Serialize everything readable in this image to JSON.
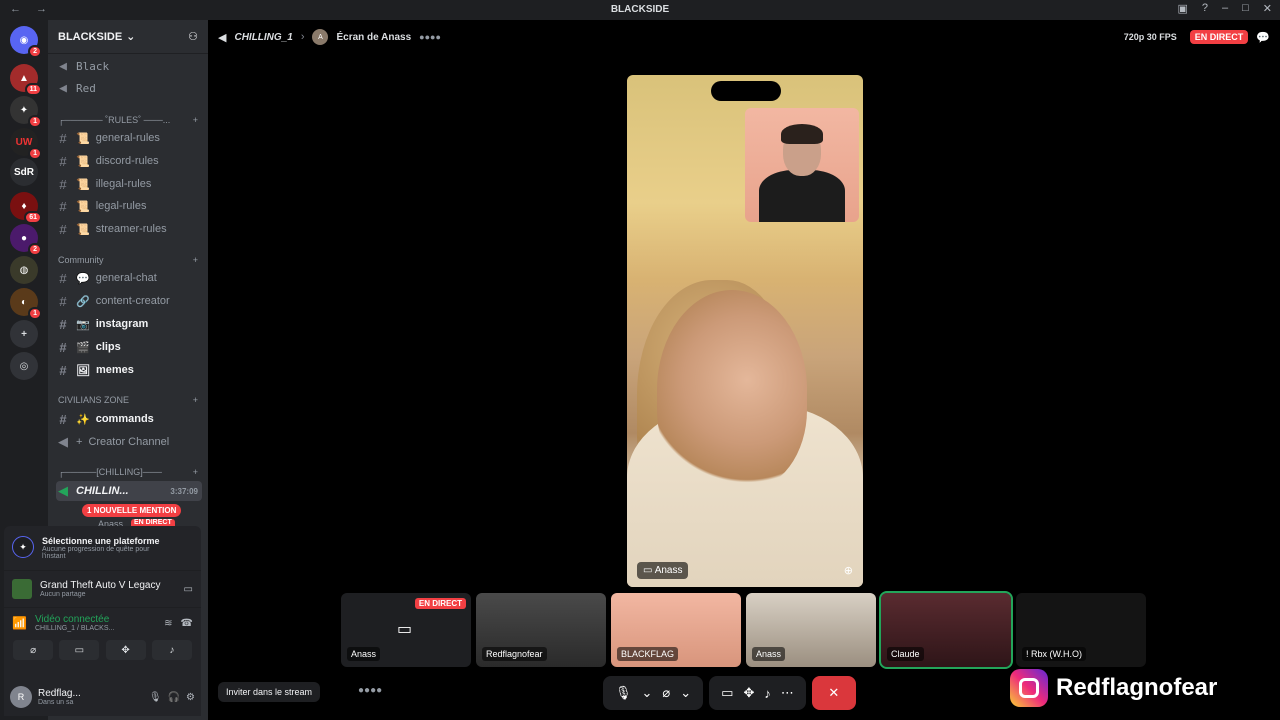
{
  "window": {
    "title": "BLACKSIDE"
  },
  "server": {
    "name": "BLACKSIDE",
    "channels_top": [
      "Black",
      "Red"
    ],
    "rules_category": "┌────── ˚RULES˚ ───...",
    "rules": [
      "general-rules",
      "discord-rules",
      "illegal-rules",
      "legal-rules",
      "streamer-rules"
    ],
    "community_category": "Community",
    "community": [
      {
        "name": "general-chat",
        "bold": false
      },
      {
        "name": "content-creator",
        "bold": false
      },
      {
        "name": "instagram",
        "bold": true
      },
      {
        "name": "clips",
        "bold": true
      },
      {
        "name": "memes",
        "bold": true
      }
    ],
    "civilians_category": "CIVILIANS ZONE",
    "commands": "commands",
    "creator_channel": "Creator Channel",
    "chilling_category": "┌─────[CHILLING]───",
    "voice_channel": "CHILLIN...",
    "voice_time": "3:37:09",
    "mention": "1 NOUVELLE MENTION",
    "voice_member": "Anass",
    "live": "EN DIRECT"
  },
  "guild_badges": [
    "2",
    "11",
    "1",
    "1",
    "61",
    "2",
    "1"
  ],
  "guild_label": "SdR",
  "topbar": {
    "channel": "CHILLING_1",
    "screen": "Écran de Anass",
    "quality": "720p 30 FPS",
    "live": "EN DIRECT"
  },
  "video": {
    "label": "Anass"
  },
  "tiles": [
    {
      "label": "Anass",
      "live": "EN DIRECT"
    },
    {
      "label": "Redflagnofear"
    },
    {
      "label": "BLACKFLAG"
    },
    {
      "label": "Anass"
    },
    {
      "label": "Claude"
    },
    {
      "label": "! Rbx (W.H.O)"
    }
  ],
  "panel": {
    "platform_title": "Sélectionne une plateforme",
    "platform_sub": "Aucune progression de quête pour l'instant",
    "game": "Grand Theft Auto V Legacy",
    "game_sub": "Aucun partage",
    "video_status": "Vidéo connectée",
    "video_channel": "CHILLING_1 / BLACKS..."
  },
  "user": {
    "name": "Redflag...",
    "status": "Dans un sa"
  },
  "invite": "Inviter dans le stream",
  "instagram": "Redflagnofear",
  "colors": {
    "accent": "#5865f2",
    "danger": "#da373c",
    "live": "#f23f43",
    "online": "#23a55a"
  }
}
